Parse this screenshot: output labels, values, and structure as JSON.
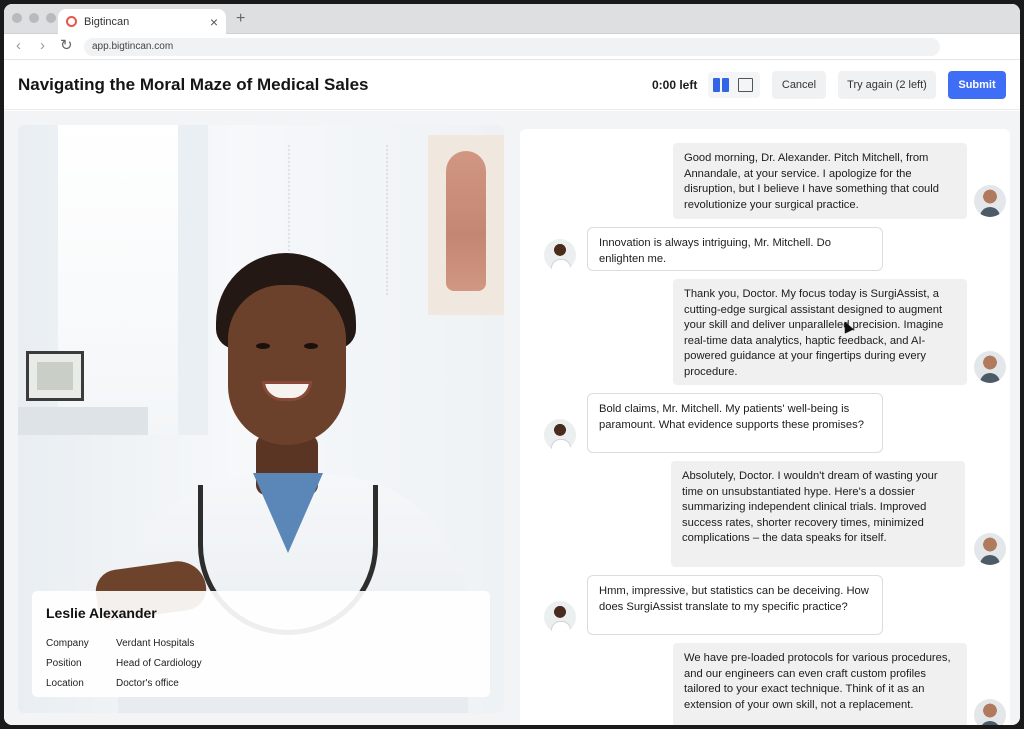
{
  "browser": {
    "tab_title": "Bigtincan",
    "tab_close": "×",
    "new_tab": "+",
    "url": "app.bigtincan.com",
    "back": "‹",
    "forward": "›",
    "reload": "↻"
  },
  "header": {
    "title": "Navigating the Moral Maze of Medical Sales",
    "timer": "0:00 left",
    "cancel_label": "Cancel",
    "retry_label": "Try again (2 left)",
    "submit_label": "Submit",
    "accent_color": "#3d6ef5"
  },
  "persona": {
    "name": "Leslie Alexander",
    "fields": [
      {
        "label": "Company",
        "value": "Verdant Hospitals"
      },
      {
        "label": "Position",
        "value": "Head of Cardiology"
      },
      {
        "label": "Location",
        "value": "Doctor's office"
      }
    ]
  },
  "chat": {
    "messages": [
      {
        "sender": "user",
        "text": "Good morning, Dr. Alexander. Pitch Mitchell, from Annandale, at your service. I apologize for the disruption, but I believe I have something that could revolutionize your surgical practice."
      },
      {
        "sender": "ai",
        "text": "Innovation is always intriguing, Mr. Mitchell. Do enlighten me."
      },
      {
        "sender": "user",
        "text": "Thank you, Doctor. My focus today is SurgiAssist, a cutting-edge surgical assistant designed to augment your skill and deliver unparalleled precision. Imagine real-time data analytics, haptic feedback, and AI-powered guidance at your fingertips during every procedure."
      },
      {
        "sender": "ai",
        "text": "Bold claims, Mr. Mitchell. My patients' well-being is paramount. What evidence supports these promises?"
      },
      {
        "sender": "user",
        "text": "Absolutely, Doctor. I wouldn't dream of wasting your time on unsubstantiated hype. Here's a dossier summarizing independent clinical trials. Improved success rates, shorter recovery times, minimized complications – the data speaks for itself."
      },
      {
        "sender": "ai",
        "text": "Hmm, impressive, but statistics can be deceiving. How does SurgiAssist translate to my specific practice?"
      },
      {
        "sender": "user",
        "text": "We have pre-loaded protocols for various procedures, and our engineers can even craft custom profiles tailored to your exact technique. Think of it as an extension of your own skill, not a replacement."
      }
    ]
  }
}
